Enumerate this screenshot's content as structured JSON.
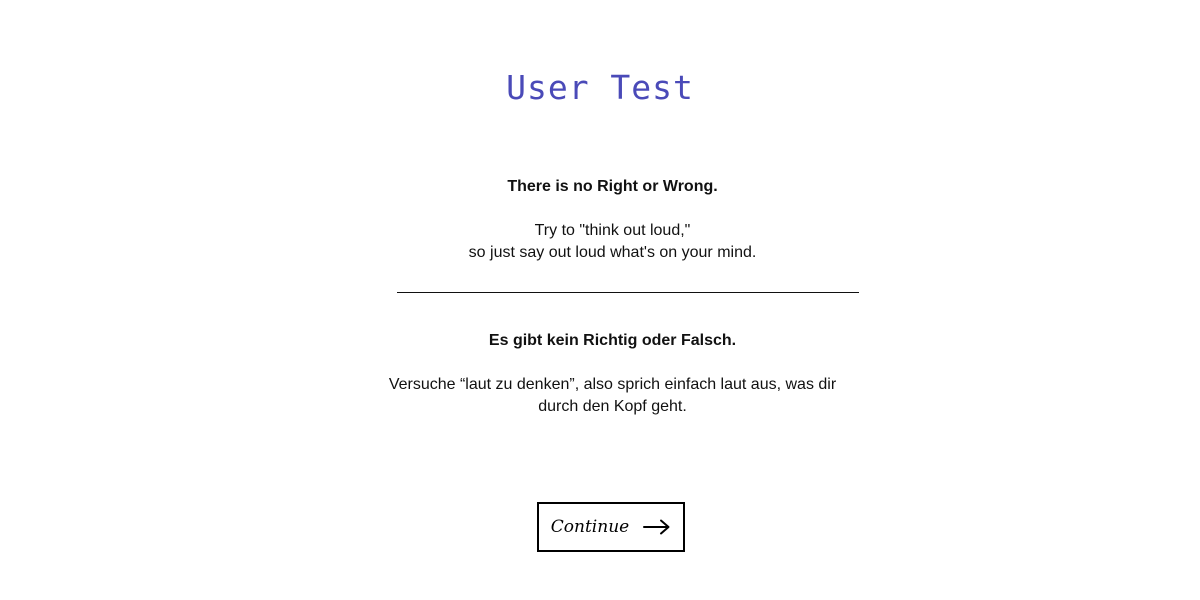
{
  "title": "User Test",
  "english": {
    "heading": "There is no Right or Wrong.",
    "line1": "Try to \"think out loud,\"",
    "line2": "so just say out loud what's on your mind."
  },
  "german": {
    "heading": "Es gibt kein Richtig oder Falsch.",
    "line1": "Versuche “laut zu denken”, also sprich einfach laut aus, was dir",
    "line2": "durch den Kopf geht."
  },
  "continue_button": {
    "label": "Continue",
    "icon": "arrow-right-icon"
  },
  "colors": {
    "title": "#4a4ab8",
    "text": "#111111",
    "button_border": "#000000",
    "background": "#ffffff"
  }
}
